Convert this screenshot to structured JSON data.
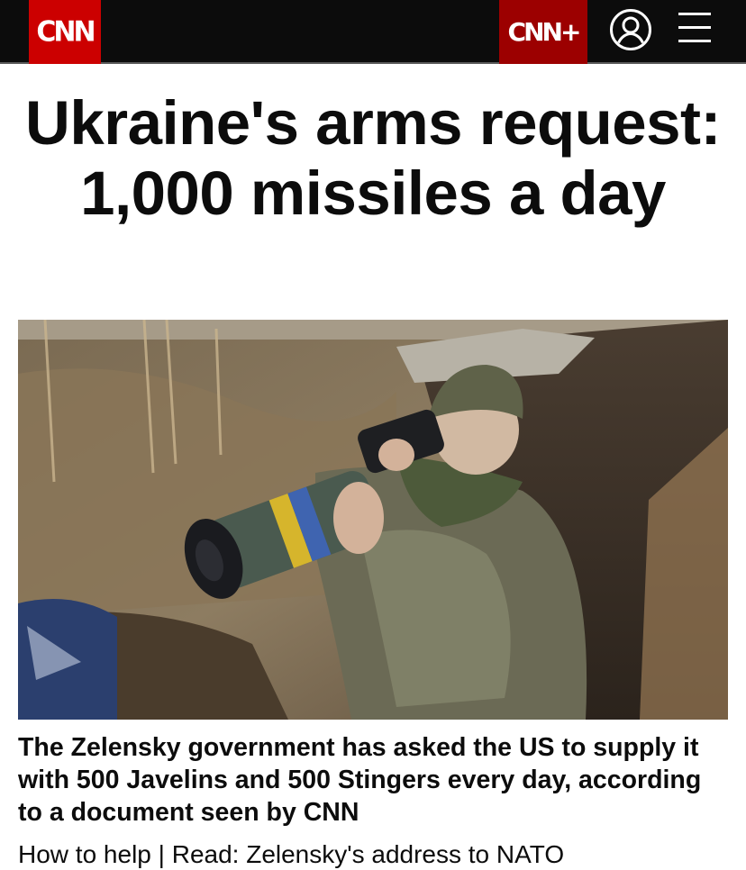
{
  "header": {
    "logo_text": "CNN",
    "cnn_plus_label": "CNN+",
    "account_icon": "user-circle-icon",
    "menu_icon": "hamburger-menu-icon",
    "colors": {
      "bar": "#0c0c0c",
      "logo": "#cc0000",
      "plus": "#9c0000"
    }
  },
  "article": {
    "headline": "Ukraine's arms request: 1,000 missiles a day",
    "image_alt": "Soldier in a trench aiming a Javelin missile launcher",
    "summary": "The Zelensky government has asked the US to supply it with 500 Javelins and 500 Stingers every day, according to a document seen by CNN",
    "links": {
      "help": "How to help",
      "separator": " | ",
      "read": "Read: Zelensky's address to NATO"
    }
  }
}
